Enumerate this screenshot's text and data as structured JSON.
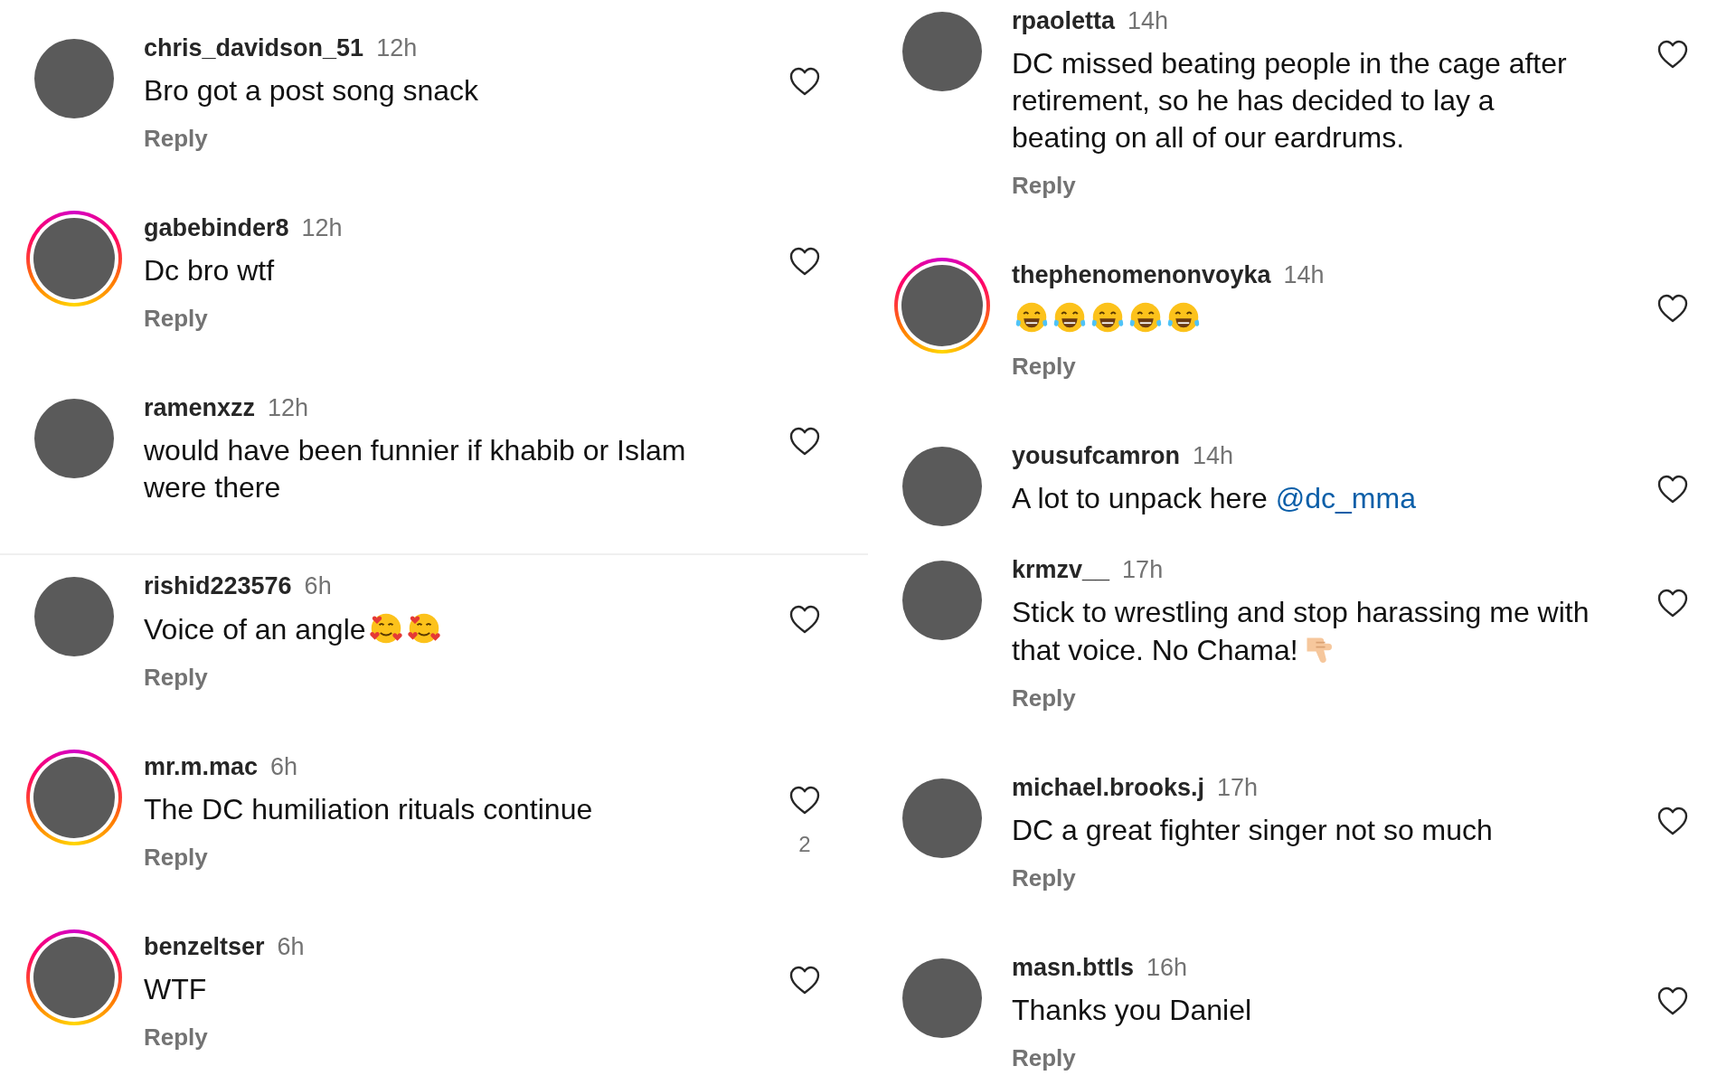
{
  "columns": [
    {
      "panels": [
        {
          "comments": [
            {
              "username": "chris_davidson_51",
              "time": "12h",
              "text": "Bro got a post song snack",
              "story_ring": false,
              "reply": "Reply",
              "liked": false
            },
            {
              "username": "gabebinder8",
              "time": "12h",
              "text": "Dc bro wtf",
              "story_ring": true,
              "reply": "Reply",
              "liked": false
            },
            {
              "username": "ramenxzz",
              "time": "12h",
              "text": "would have been funnier if khabib or Islam were there",
              "story_ring": false,
              "liked": false
            }
          ]
        },
        {
          "comments": [
            {
              "username": "rishid223576",
              "time": "6h",
              "text": "Voice of an angle",
              "emoji": [
                {
                  "kind": "smiling-hearts"
                },
                {
                  "kind": "smiling-hearts"
                }
              ],
              "story_ring": false,
              "reply": "Reply",
              "liked": false
            },
            {
              "username": "mr.m.mac",
              "time": "6h",
              "text": "The DC humiliation rituals continue",
              "story_ring": true,
              "reply": "Reply",
              "liked": false,
              "likes": "2"
            },
            {
              "username": "benzeltser",
              "time": "6h",
              "text": "WTF",
              "story_ring": true,
              "reply": "Reply",
              "liked": false
            }
          ]
        }
      ]
    },
    {
      "panels": [
        {
          "comments": [
            {
              "username": "rpaoletta",
              "time": "14h",
              "text": "DC missed beating people in the cage after retirement, so he has decided to lay a beating on all of our eardrums.",
              "story_ring": false,
              "reply": "Reply",
              "liked": false
            },
            {
              "username": "thephenomenonvoyka",
              "time": "14h",
              "emoji": [
                {
                  "kind": "tears-of-joy"
                },
                {
                  "kind": "tears-of-joy"
                },
                {
                  "kind": "tears-of-joy"
                },
                {
                  "kind": "tears-of-joy"
                },
                {
                  "kind": "tears-of-joy"
                }
              ],
              "story_ring": true,
              "reply": "Reply",
              "liked": false
            },
            {
              "username": "yousufcamron",
              "time": "14h",
              "text": "A lot to unpack here",
              "mention": "@dc_mma",
              "story_ring": false,
              "liked": false
            },
            {
              "username": "krmzv__",
              "time": "17h",
              "text": "Stick to wrestling and stop harassing me with that voice. No Chama!",
              "emoji": [
                {
                  "kind": "thumbs-down"
                }
              ],
              "story_ring": false,
              "reply": "Reply",
              "liked": false
            },
            {
              "username": "michael.brooks.j",
              "time": "17h",
              "text": "DC a great fighter singer not so much",
              "story_ring": false,
              "reply": "Reply",
              "liked": false
            },
            {
              "username": "masn.bttls",
              "time": "16h",
              "text": "Thanks you Daniel",
              "story_ring": false,
              "reply": "Reply",
              "liked": false
            }
          ]
        }
      ]
    }
  ]
}
